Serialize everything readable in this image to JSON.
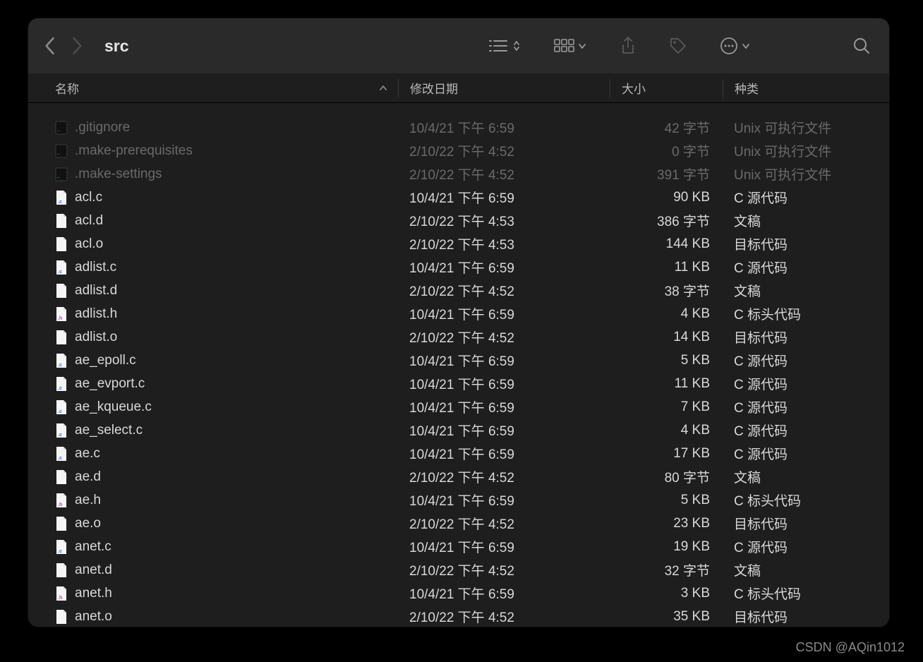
{
  "window": {
    "title": "src"
  },
  "columns": {
    "name": "名称",
    "date": "修改日期",
    "size": "大小",
    "kind": "种类"
  },
  "watermark": "CSDN @AQin1012",
  "files": [
    {
      "icon": "exec",
      "dim": true,
      "name": ".gitignore",
      "date": "10/4/21 下午 6:59",
      "size": "42 字节",
      "kind": "Unix 可执行文件"
    },
    {
      "icon": "exec",
      "dim": true,
      "name": ".make-prerequisites",
      "date": "2/10/22 下午 4:52",
      "size": "0 字节",
      "kind": "Unix 可执行文件"
    },
    {
      "icon": "exec",
      "dim": true,
      "name": ".make-settings",
      "date": "2/10/22 下午 4:52",
      "size": "391 字节",
      "kind": "Unix 可执行文件"
    },
    {
      "icon": "c",
      "dim": false,
      "name": "acl.c",
      "date": "10/4/21 下午 6:59",
      "size": "90 KB",
      "kind": "C 源代码"
    },
    {
      "icon": "doc",
      "dim": false,
      "name": "acl.d",
      "date": "2/10/22 下午 4:53",
      "size": "386 字节",
      "kind": "文稿"
    },
    {
      "icon": "doc",
      "dim": false,
      "name": "acl.o",
      "date": "2/10/22 下午 4:53",
      "size": "144 KB",
      "kind": "目标代码"
    },
    {
      "icon": "c",
      "dim": false,
      "name": "adlist.c",
      "date": "10/4/21 下午 6:59",
      "size": "11 KB",
      "kind": "C 源代码"
    },
    {
      "icon": "doc",
      "dim": false,
      "name": "adlist.d",
      "date": "2/10/22 下午 4:52",
      "size": "38 字节",
      "kind": "文稿"
    },
    {
      "icon": "h",
      "dim": false,
      "name": "adlist.h",
      "date": "10/4/21 下午 6:59",
      "size": "4 KB",
      "kind": "C 标头代码"
    },
    {
      "icon": "doc",
      "dim": false,
      "name": "adlist.o",
      "date": "2/10/22 下午 4:52",
      "size": "14 KB",
      "kind": "目标代码"
    },
    {
      "icon": "c",
      "dim": false,
      "name": "ae_epoll.c",
      "date": "10/4/21 下午 6:59",
      "size": "5 KB",
      "kind": "C 源代码"
    },
    {
      "icon": "c",
      "dim": false,
      "name": "ae_evport.c",
      "date": "10/4/21 下午 6:59",
      "size": "11 KB",
      "kind": "C 源代码"
    },
    {
      "icon": "c",
      "dim": false,
      "name": "ae_kqueue.c",
      "date": "10/4/21 下午 6:59",
      "size": "7 KB",
      "kind": "C 源代码"
    },
    {
      "icon": "c",
      "dim": false,
      "name": "ae_select.c",
      "date": "10/4/21 下午 6:59",
      "size": "4 KB",
      "kind": "C 源代码"
    },
    {
      "icon": "c",
      "dim": false,
      "name": "ae.c",
      "date": "10/4/21 下午 6:59",
      "size": "17 KB",
      "kind": "C 源代码"
    },
    {
      "icon": "doc",
      "dim": false,
      "name": "ae.d",
      "date": "2/10/22 下午 4:52",
      "size": "80 字节",
      "kind": "文稿"
    },
    {
      "icon": "h",
      "dim": false,
      "name": "ae.h",
      "date": "10/4/21 下午 6:59",
      "size": "5 KB",
      "kind": "C 标头代码"
    },
    {
      "icon": "doc",
      "dim": false,
      "name": "ae.o",
      "date": "2/10/22 下午 4:52",
      "size": "23 KB",
      "kind": "目标代码"
    },
    {
      "icon": "c",
      "dim": false,
      "name": "anet.c",
      "date": "10/4/21 下午 6:59",
      "size": "19 KB",
      "kind": "C 源代码"
    },
    {
      "icon": "doc",
      "dim": false,
      "name": "anet.d",
      "date": "2/10/22 下午 4:52",
      "size": "32 字节",
      "kind": "文稿"
    },
    {
      "icon": "h",
      "dim": false,
      "name": "anet.h",
      "date": "10/4/21 下午 6:59",
      "size": "3 KB",
      "kind": "C 标头代码"
    },
    {
      "icon": "doc",
      "dim": false,
      "name": "anet.o",
      "date": "2/10/22 下午 4:52",
      "size": "35 KB",
      "kind": "目标代码"
    }
  ]
}
